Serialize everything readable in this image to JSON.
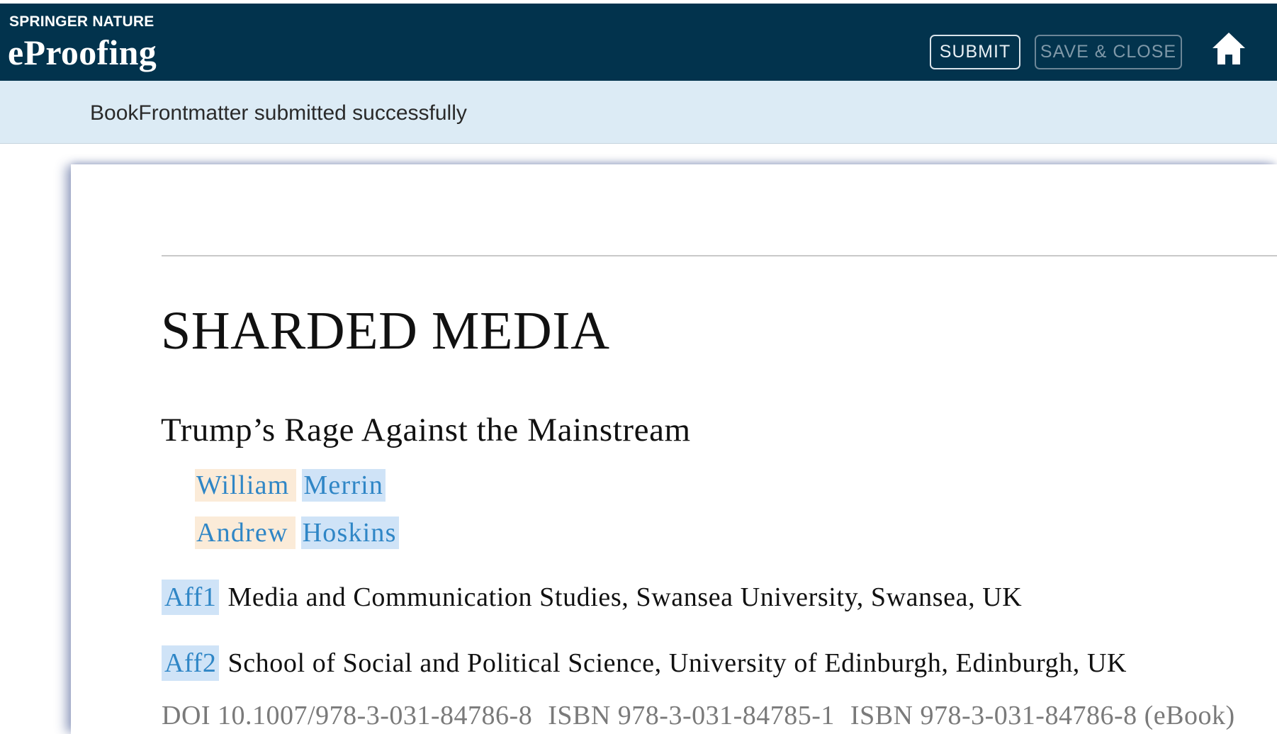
{
  "header": {
    "brand_top": "SPRINGER NATURE",
    "brand_main": "eProofing",
    "submit_label": "SUBMIT",
    "save_close_label": "SAVE & CLOSE",
    "home_icon": "home-icon",
    "bg_color": "#02334d"
  },
  "notice": {
    "message": "BookFrontmatter submitted successfully",
    "bg_color": "#dcebf5"
  },
  "document": {
    "title": "SHARDED MEDIA",
    "subtitle": "Trump’s Rage Against the Mainstream",
    "authors": [
      {
        "given": "William",
        "family": "Merrin"
      },
      {
        "given": "Andrew",
        "family": "Hoskins"
      }
    ],
    "affiliations": [
      {
        "tag": "Aff1",
        "text": "Media and Communication Studies, Swansea University, Swansea, UK"
      },
      {
        "tag": "Aff2",
        "text": "School of Social and Political Science, University of Edinburgh, Edinburgh, UK"
      }
    ],
    "identifiers": {
      "doi": "DOI 10.1007/978-3-031-84786-8",
      "isbn_print": "ISBN 978-3-031-84785-1",
      "isbn_ebook": "ISBN 978-3-031-84786-8 (eBook)"
    },
    "link_color": "#2f86c6"
  }
}
